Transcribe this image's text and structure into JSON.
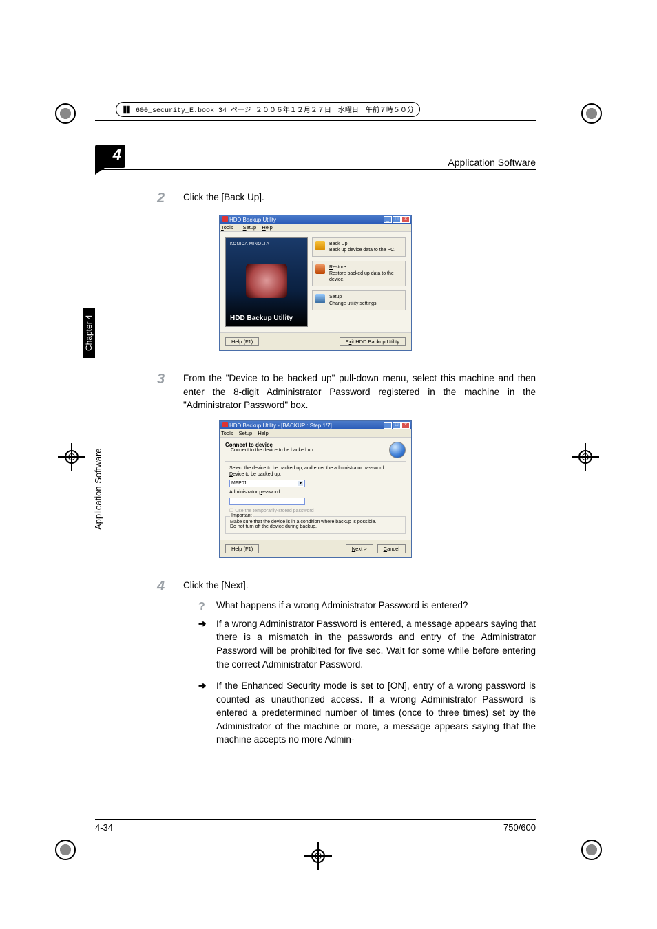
{
  "crop_header_text": "600_security_E.book  34 ページ  ２００６年１２月２７日　水曜日　午前７時５０分",
  "header": {
    "chapter_num": "4",
    "running_title": "Application Software"
  },
  "side": {
    "tab": "Chapter 4",
    "text": "Application Software"
  },
  "steps": {
    "s2": {
      "num": "2",
      "text": "Click the [Back Up]."
    },
    "s3": {
      "num": "3",
      "text": "From the \"Device to be backed up\" pull-down menu, select this machine and then enter the 8-digit Administrator Password registered in the machine in the \"Administrator Password\" box."
    },
    "s4": {
      "num": "4",
      "text": "Click the [Next]."
    }
  },
  "win1": {
    "title": "HDD Backup Utility",
    "menu": {
      "tools": "Tools",
      "setup": "Setup",
      "help": "Help"
    },
    "km": "KONICA MINOLTA",
    "app_title": "HDD Backup Utility",
    "opt_backup": {
      "t": "Back Up",
      "d": "Back up device data to the PC."
    },
    "opt_restore": {
      "t": "Restore",
      "d": "Restore backed up data to the device."
    },
    "opt_setup": {
      "t": "Setup",
      "d": "Change utility settings."
    },
    "help_btn": "Help (F1)",
    "exit_btn": "Exit HDD Backup Utility"
  },
  "win2": {
    "title": "HDD Backup Utility - [BACKUP : Step 1/7]",
    "menu": {
      "tools": "Tools",
      "setup": "Setup",
      "help": "Help"
    },
    "head_b": "Connect to device",
    "head_s": "Connect to the device to be backed up.",
    "instr": "Select the device to be backed up, and enter the administrator password.",
    "dev_label": "Device to be backed up:",
    "dev_value": "MFP01",
    "pw_label": "Administrator password:",
    "chk_grey": "Use the temporarily-stored password",
    "imp_label": "Important",
    "imp_l1": "Make sure that the device is in a condition where backup is possible.",
    "imp_l2": "Do not turn off the device during backup.",
    "help_btn": "Help (F1)",
    "next_btn": "Next >",
    "cancel_btn": "Cancel"
  },
  "qa": {
    "q": "What happens if a wrong Administrator Password is entered?",
    "a1": "If a wrong Administrator Password is entered, a message appears saying that there is a mismatch in the passwords and entry of the Administrator Password will be prohibited for five sec. Wait for some while before entering the correct Administrator Password.",
    "a2": "If the Enhanced Security mode is set to [ON], entry of a wrong password is counted as unauthorized access. If a wrong Administrator Password is entered a predetermined number of times (once to three times) set by the Administrator of the machine or more, a message appears saying that the machine accepts no more Admin-"
  },
  "footer": {
    "page": "4-34",
    "model": "750/600"
  }
}
